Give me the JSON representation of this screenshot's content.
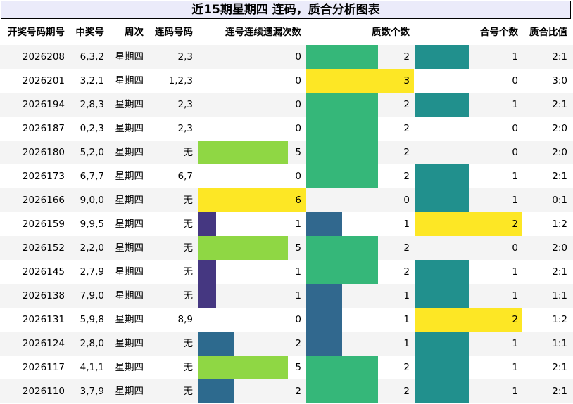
{
  "title": "近15期星期四 连码，质合分析图表",
  "colors": {
    "title_bg": "#ebebfa",
    "scale": {
      "0": "#ffffff",
      "1": "#453781",
      "2": "#2d6a8e",
      "3": "#1e9a8a",
      "4": "#21908d",
      "5": "#8fd744",
      "6": "#fde725"
    },
    "prime_scale": {
      "0": "#ffffff",
      "1": "#31688e",
      "2": "#35b779",
      "3": "#fde725"
    },
    "composite_scale": {
      "0": "#ffffff",
      "1": "#21908d",
      "2": "#fde725"
    }
  },
  "chart_data": {
    "type": "table",
    "title": "近15期星期四 连码，质合分析图表",
    "columns": [
      "开奖号码期号",
      "中奖号",
      "周次",
      "连码号码",
      "连号连续遗漏次数",
      "质数个数",
      "合号个数",
      "质合比值"
    ],
    "rows": [
      {
        "issue": "2026208",
        "number": "6,3,2",
        "week": "星期四",
        "consecutive": "2,3",
        "miss": 0,
        "prime": 2,
        "composite": 1,
        "ratio": "2:1"
      },
      {
        "issue": "2026201",
        "number": "3,2,1",
        "week": "星期四",
        "consecutive": "1,2,3",
        "miss": 0,
        "prime": 3,
        "composite": 0,
        "ratio": "3:0"
      },
      {
        "issue": "2026194",
        "number": "2,8,3",
        "week": "星期四",
        "consecutive": "2,3",
        "miss": 0,
        "prime": 2,
        "composite": 1,
        "ratio": "2:1"
      },
      {
        "issue": "2026187",
        "number": "0,2,3",
        "week": "星期四",
        "consecutive": "2,3",
        "miss": 0,
        "prime": 2,
        "composite": 0,
        "ratio": "2:0"
      },
      {
        "issue": "2026180",
        "number": "5,2,0",
        "week": "星期四",
        "consecutive": "无",
        "miss": 5,
        "prime": 2,
        "composite": 0,
        "ratio": "2:0"
      },
      {
        "issue": "2026173",
        "number": "6,7,7",
        "week": "星期四",
        "consecutive": "6,7",
        "miss": 0,
        "prime": 2,
        "composite": 1,
        "ratio": "2:1"
      },
      {
        "issue": "2026166",
        "number": "9,0,0",
        "week": "星期四",
        "consecutive": "无",
        "miss": 6,
        "prime": 0,
        "composite": 1,
        "ratio": "0:1"
      },
      {
        "issue": "2026159",
        "number": "9,9,5",
        "week": "星期四",
        "consecutive": "无",
        "miss": 1,
        "prime": 1,
        "composite": 2,
        "ratio": "1:2"
      },
      {
        "issue": "2026152",
        "number": "2,2,0",
        "week": "星期四",
        "consecutive": "无",
        "miss": 5,
        "prime": 2,
        "composite": 0,
        "ratio": "2:0"
      },
      {
        "issue": "2026145",
        "number": "2,7,9",
        "week": "星期四",
        "consecutive": "无",
        "miss": 1,
        "prime": 2,
        "composite": 1,
        "ratio": "2:1"
      },
      {
        "issue": "2026138",
        "number": "7,9,0",
        "week": "星期四",
        "consecutive": "无",
        "miss": 1,
        "prime": 1,
        "composite": 1,
        "ratio": "1:1"
      },
      {
        "issue": "2026131",
        "number": "5,9,8",
        "week": "星期四",
        "consecutive": "8,9",
        "miss": 0,
        "prime": 1,
        "composite": 2,
        "ratio": "1:2"
      },
      {
        "issue": "2026124",
        "number": "2,8,0",
        "week": "星期四",
        "consecutive": "无",
        "miss": 2,
        "prime": 1,
        "composite": 1,
        "ratio": "1:1"
      },
      {
        "issue": "2026117",
        "number": "4,1,1",
        "week": "星期四",
        "consecutive": "无",
        "miss": 5,
        "prime": 2,
        "composite": 1,
        "ratio": "2:1"
      },
      {
        "issue": "2026110",
        "number": "3,7,9",
        "week": "星期四",
        "consecutive": "无",
        "miss": 2,
        "prime": 2,
        "composite": 1,
        "ratio": "2:1"
      }
    ]
  }
}
